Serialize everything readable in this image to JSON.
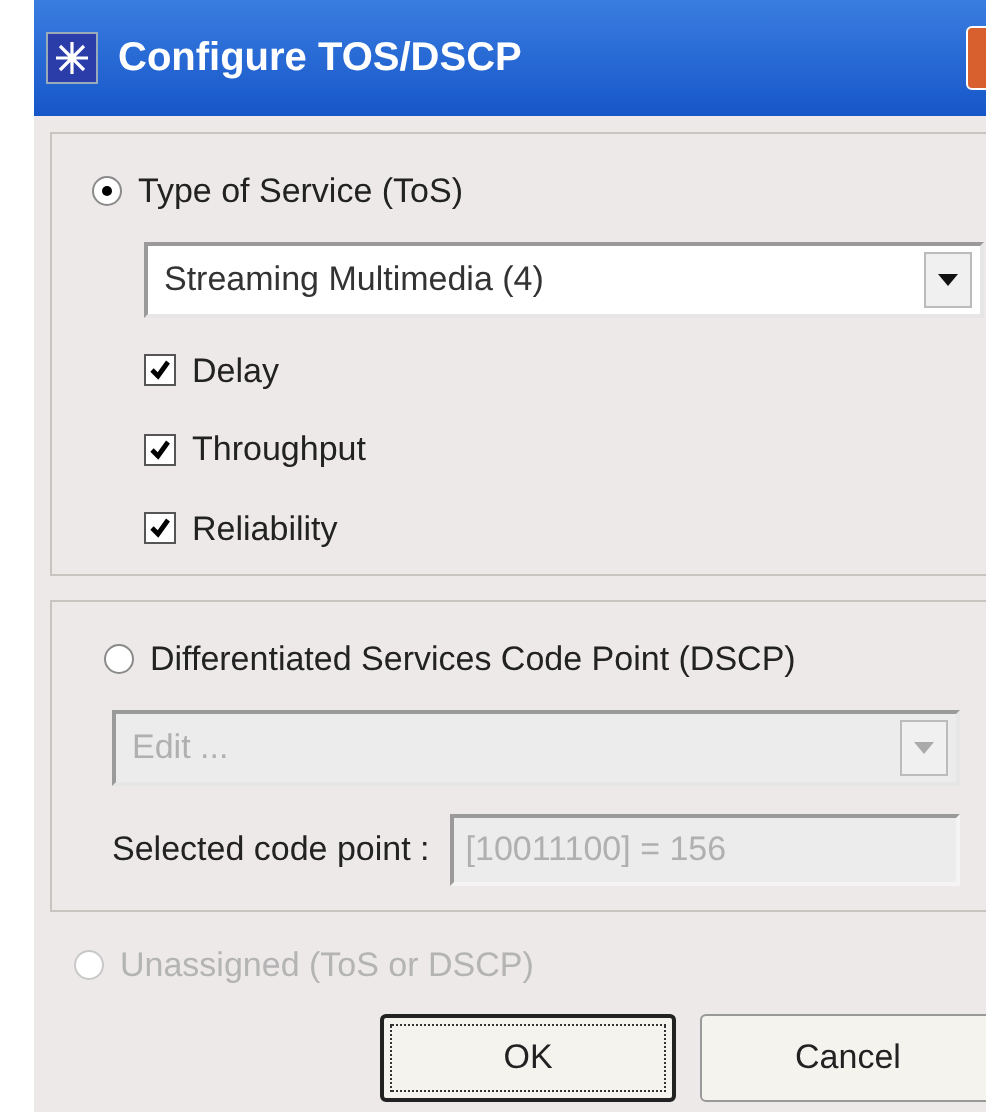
{
  "window": {
    "title": "Configure TOS/DSCP"
  },
  "tos": {
    "radio": {
      "label": "Type of Service (ToS)",
      "selected": true,
      "disabled": false
    },
    "combo": {
      "value": "Streaming Multimedia (4)",
      "disabled": false
    },
    "checkboxes": [
      {
        "label": "Delay",
        "checked": true
      },
      {
        "label": "Throughput",
        "checked": true
      },
      {
        "label": "Reliability",
        "checked": true
      }
    ]
  },
  "dscp": {
    "radio": {
      "label": "Differentiated Services Code Point (DSCP)",
      "selected": false,
      "disabled": false
    },
    "combo": {
      "value": "Edit ...",
      "disabled": true
    },
    "code_point_label": "Selected code point :",
    "code_point_value": "[10011100] = 156"
  },
  "unassigned": {
    "label": "Unassigned (ToS or DSCP)",
    "selected": false,
    "disabled": true
  },
  "buttons": [
    {
      "label": "OK",
      "default": true
    },
    {
      "label": "Cancel",
      "default": false
    }
  ]
}
